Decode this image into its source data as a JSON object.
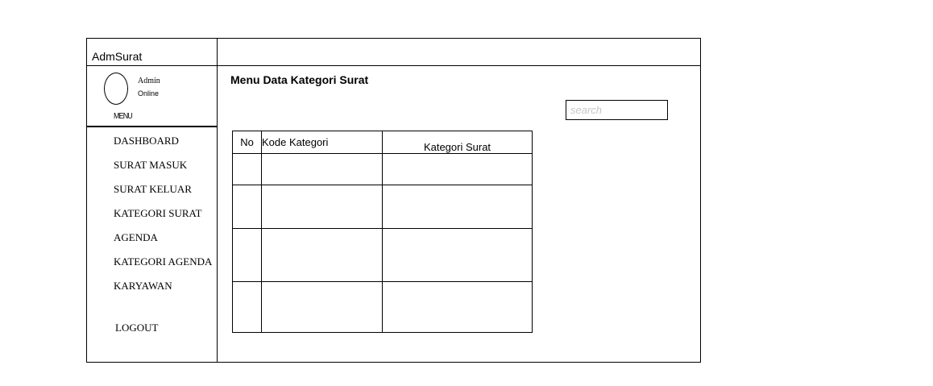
{
  "app": {
    "title": "AdmSurat"
  },
  "user": {
    "name": "Admin",
    "status": "Online"
  },
  "sidebar": {
    "menu_label": "MENU",
    "items": [
      {
        "label": "DASHBOARD"
      },
      {
        "label": "SURAT MASUK"
      },
      {
        "label": "SURAT KELUAR"
      },
      {
        "label": "KATEGORI SURAT"
      },
      {
        "label": "AGENDA"
      },
      {
        "label": "KATEGORI AGENDA"
      },
      {
        "label": "KARYAWAN"
      }
    ],
    "logout_label": "LOGOUT"
  },
  "main": {
    "title": "Menu Data Kategori Surat",
    "search": {
      "placeholder": "search",
      "value": ""
    },
    "table": {
      "columns": [
        "No",
        "Kode Kategori",
        "Kategori Surat"
      ],
      "rows": [
        [
          "",
          "",
          ""
        ],
        [
          "",
          "",
          ""
        ],
        [
          "",
          "",
          ""
        ],
        [
          "",
          "",
          ""
        ]
      ]
    }
  },
  "colors": {
    "border": "#000000",
    "background": "#ffffff",
    "placeholder": "#c8c8c8"
  }
}
